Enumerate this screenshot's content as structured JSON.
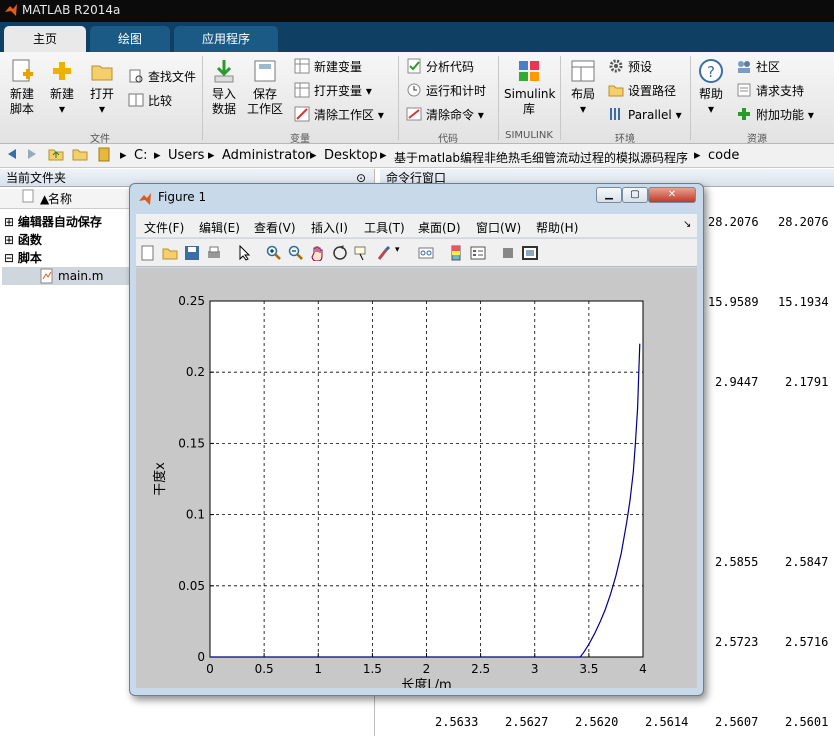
{
  "app": {
    "title": "MATLAB R2014a"
  },
  "tabs": [
    {
      "label": "主页"
    },
    {
      "label": "绘图"
    },
    {
      "label": "应用程序"
    }
  ],
  "ribbon": {
    "file": {
      "new_script_l1": "新建",
      "new_script_l2": "脚本",
      "new": "新建",
      "open": "打开",
      "find_files": "查找文件",
      "compare": "比较",
      "group": "文件"
    },
    "variable": {
      "import_l1": "导入",
      "import_l2": "数据",
      "save_l1": "保存",
      "save_l2": "工作区",
      "new_var": "新建变量",
      "open_var": "打开变量",
      "clear_ws": "清除工作区",
      "group": "变量"
    },
    "code": {
      "analyze": "分析代码",
      "run_time": "运行和计时",
      "clear_cmd": "清除命令",
      "group": "代码"
    },
    "simulink": {
      "lib_l1": "Simulink",
      "lib_l2": "库",
      "group": "SIMULINK"
    },
    "env": {
      "layout": "布局",
      "prefs": "预设",
      "set_path": "设置路径",
      "parallel": "Parallel",
      "group": "环境"
    },
    "resources": {
      "help": "帮助",
      "community": "社区",
      "support": "请求支持",
      "addons": "附加功能",
      "group": "资源"
    }
  },
  "address": {
    "parts": [
      "C:",
      "Users",
      "Administrator",
      "Desktop",
      "基于matlab编程非绝热毛细管流动过程的模拟源码程序",
      "code"
    ]
  },
  "current_folder": {
    "title": "当前文件夹",
    "col_name": "名称",
    "items": [
      {
        "label": "编辑器自动保存"
      },
      {
        "label": "函数"
      },
      {
        "label": "脚本"
      }
    ],
    "file": "main.m"
  },
  "command_window": {
    "title": "命令行窗口",
    "rows": [
      [
        "28.2076",
        "28.2076"
      ],
      [
        "15.9589",
        "15.1934"
      ],
      [
        "2.9447",
        "2.1791"
      ],
      [
        "2.5855",
        "2.5847"
      ],
      [
        "2.5723",
        "2.5716"
      ]
    ],
    "last_row": [
      "2.5633",
      "2.5627",
      "2.5620",
      "2.5614",
      "2.5607",
      "2.5601"
    ]
  },
  "figure": {
    "title": "Figure 1",
    "menus": [
      "文件(F)",
      "编辑(E)",
      "查看(V)",
      "插入(I)",
      "工具(T)",
      "桌面(D)",
      "窗口(W)",
      "帮助(H)"
    ]
  },
  "chart_data": {
    "type": "line",
    "xlabel": "长度L/m",
    "ylabel": "干度x",
    "xlim": [
      0,
      4
    ],
    "ylim": [
      0,
      0.25
    ],
    "xticks": [
      "0",
      "0.5",
      "1",
      "1.5",
      "2",
      "2.5",
      "3",
      "3.5",
      "4"
    ],
    "yticks": [
      "0",
      "0.05",
      "0.1",
      "0.15",
      "0.2",
      "0.25"
    ],
    "grid": true,
    "series": [
      {
        "color": "#00008b",
        "x": [
          0,
          3.42,
          3.45,
          3.5,
          3.55,
          3.6,
          3.65,
          3.7,
          3.75,
          3.8,
          3.85,
          3.88,
          3.91,
          3.93,
          3.95,
          3.96,
          3.97
        ],
        "y": [
          0,
          0,
          0.003,
          0.009,
          0.016,
          0.024,
          0.033,
          0.044,
          0.057,
          0.073,
          0.095,
          0.11,
          0.13,
          0.15,
          0.175,
          0.198,
          0.22
        ]
      }
    ]
  }
}
